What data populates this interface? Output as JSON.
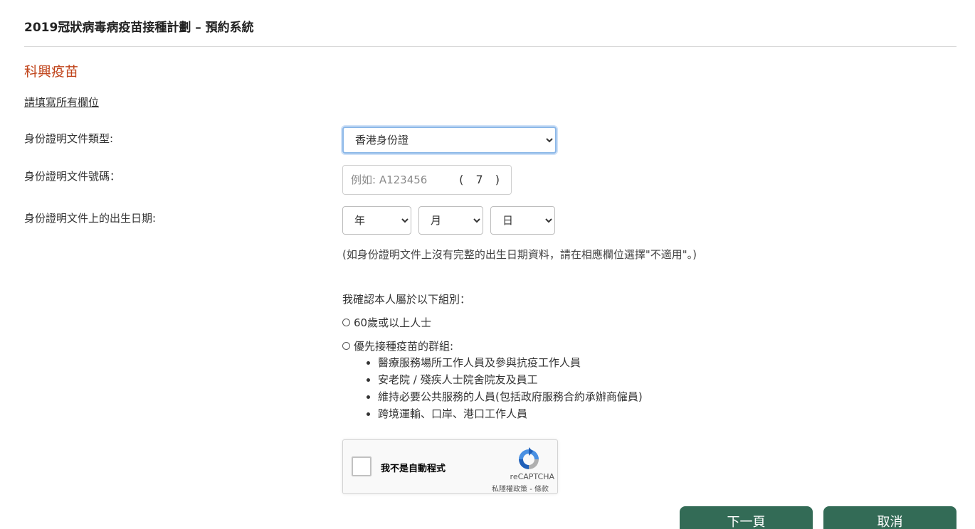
{
  "header": {
    "title": "2019冠狀病毒病疫苗接種計劃 – 預約系統"
  },
  "main": {
    "vaccine_title": "科興疫苗",
    "required_note": "請填寫所有欄位",
    "doc_type": {
      "label": "身份證明文件類型:",
      "selected": "香港身份證"
    },
    "doc_number": {
      "label": "身份證明文件號碼：",
      "placeholder": "例如: A123456",
      "check_digit": "( 7 )"
    },
    "dob": {
      "label": "身份證明文件上的出生日期:",
      "year": "年",
      "month": "月",
      "day": "日",
      "note": "(如身份證明文件上沒有完整的出生日期資料，請在相應欄位選擇\"不適用\"。)"
    },
    "confirm": {
      "prompt": "我確認本人屬於以下組別：",
      "option_1": "60歲或以上人士",
      "option_2": "優先接種疫苗的群組:",
      "groups": [
        "醫療服務場所工作人員及參與抗疫工作人員",
        "安老院 / 殘疾人士院舍院友及員工",
        "維持必要公共服務的人員(包括政府服務合約承辦商僱員)",
        "跨境運輸、口岸、港口工作人員"
      ]
    },
    "recaptcha": {
      "label": "我不是自動程式",
      "brand": "reCAPTCHA",
      "terms": "私隱權政策 - 條款"
    },
    "buttons": {
      "next": "下一頁",
      "cancel": "取消"
    }
  },
  "colors": {
    "accent_title": "#c0441b",
    "button": "#336b56"
  }
}
